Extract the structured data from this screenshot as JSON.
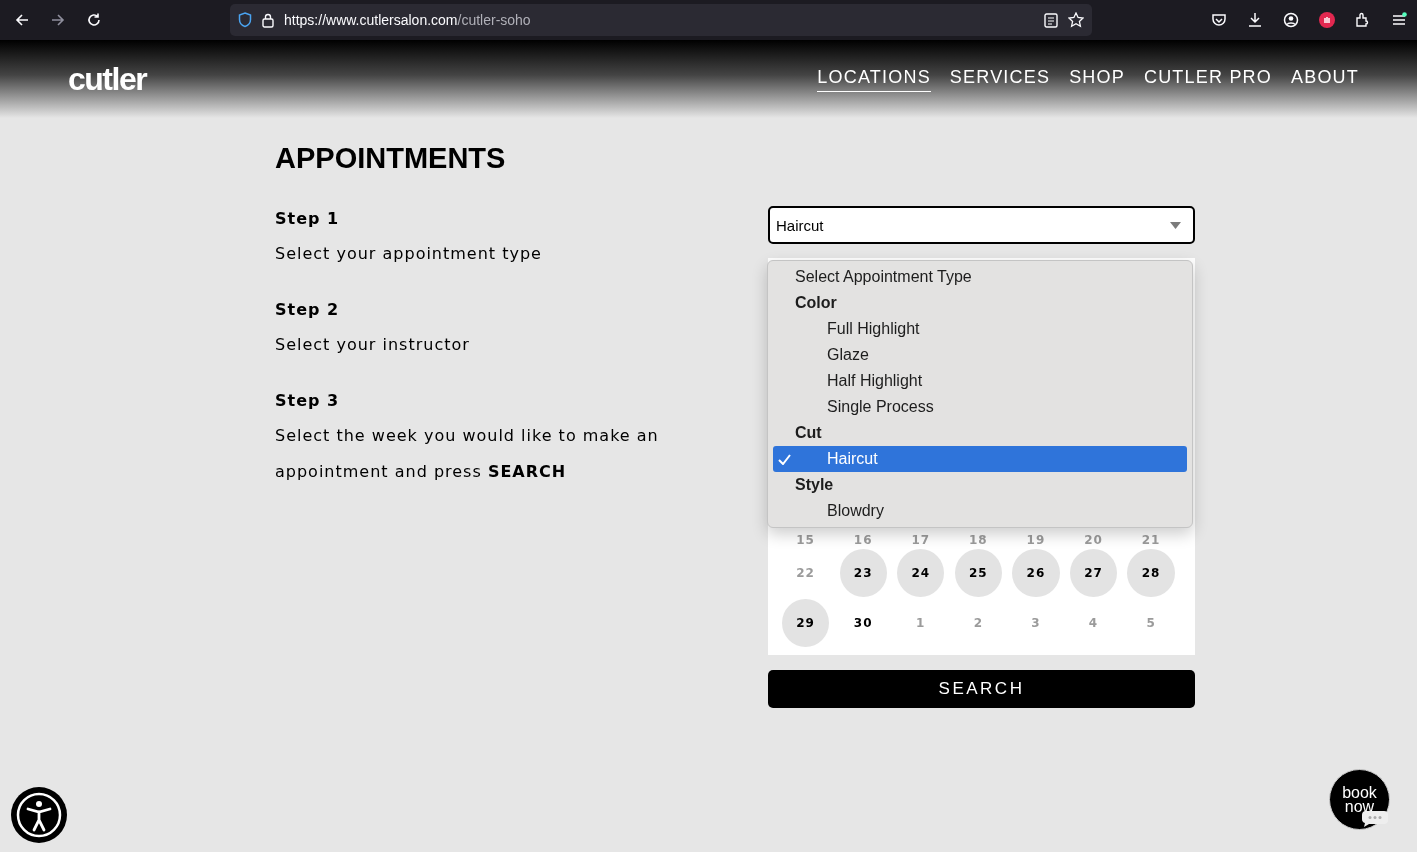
{
  "browser": {
    "url_host": "https://www.cutlersalon.com",
    "url_path": "/cutler-soho"
  },
  "site": {
    "logo": "cutler",
    "nav": [
      {
        "label": "LOCATIONS",
        "selected": true
      },
      {
        "label": "SERVICES",
        "selected": false
      },
      {
        "label": "SHOP",
        "selected": false
      },
      {
        "label": "CUTLER PRO",
        "selected": false
      },
      {
        "label": "ABOUT",
        "selected": false
      }
    ]
  },
  "page": {
    "title": "APPOINTMENTS",
    "steps": [
      {
        "label": "Step 1",
        "text": "Select your appointment type"
      },
      {
        "label": "Step 2",
        "text": "Select your instructor"
      },
      {
        "label": "Step 3",
        "text": "Select the week you would like to make an appointment and press **SEARCH**"
      }
    ]
  },
  "type_select": {
    "value": "Haircut",
    "options": [
      {
        "kind": "option",
        "label": "Select Appointment Type",
        "selected": false
      },
      {
        "kind": "group",
        "label": "Color"
      },
      {
        "kind": "suboption",
        "label": "Full Highlight",
        "selected": false
      },
      {
        "kind": "suboption",
        "label": "Glaze",
        "selected": false
      },
      {
        "kind": "suboption",
        "label": "Half Highlight",
        "selected": false
      },
      {
        "kind": "suboption",
        "label": "Single Process",
        "selected": false
      },
      {
        "kind": "group",
        "label": "Cut"
      },
      {
        "kind": "suboption",
        "label": "Haircut",
        "selected": true
      },
      {
        "kind": "group",
        "label": "Style"
      },
      {
        "kind": "suboption",
        "label": "Blowdry",
        "selected": false
      }
    ]
  },
  "calendar": {
    "weeks": [
      [
        {
          "day": "15",
          "kind": "muted"
        },
        {
          "day": "16",
          "kind": "muted"
        },
        {
          "day": "17",
          "kind": "muted"
        },
        {
          "day": "18",
          "kind": "muted"
        },
        {
          "day": "19",
          "kind": "muted"
        },
        {
          "day": "20",
          "kind": "muted"
        },
        {
          "day": "21",
          "kind": "muted"
        }
      ],
      [
        {
          "day": "22",
          "kind": "muted"
        },
        {
          "day": "23",
          "kind": "available"
        },
        {
          "day": "24",
          "kind": "available"
        },
        {
          "day": "25",
          "kind": "available"
        },
        {
          "day": "26",
          "kind": "available"
        },
        {
          "day": "27",
          "kind": "available"
        },
        {
          "day": "28",
          "kind": "available"
        }
      ],
      [
        {
          "day": "29",
          "kind": "available"
        },
        {
          "day": "30",
          "kind": "plain"
        },
        {
          "day": "1",
          "kind": "muted"
        },
        {
          "day": "2",
          "kind": "muted"
        },
        {
          "day": "3",
          "kind": "muted"
        },
        {
          "day": "4",
          "kind": "muted"
        },
        {
          "day": "5",
          "kind": "muted"
        }
      ]
    ]
  },
  "search_button": "SEARCH",
  "book_now": {
    "line_1": "book",
    "line_2": "now"
  }
}
